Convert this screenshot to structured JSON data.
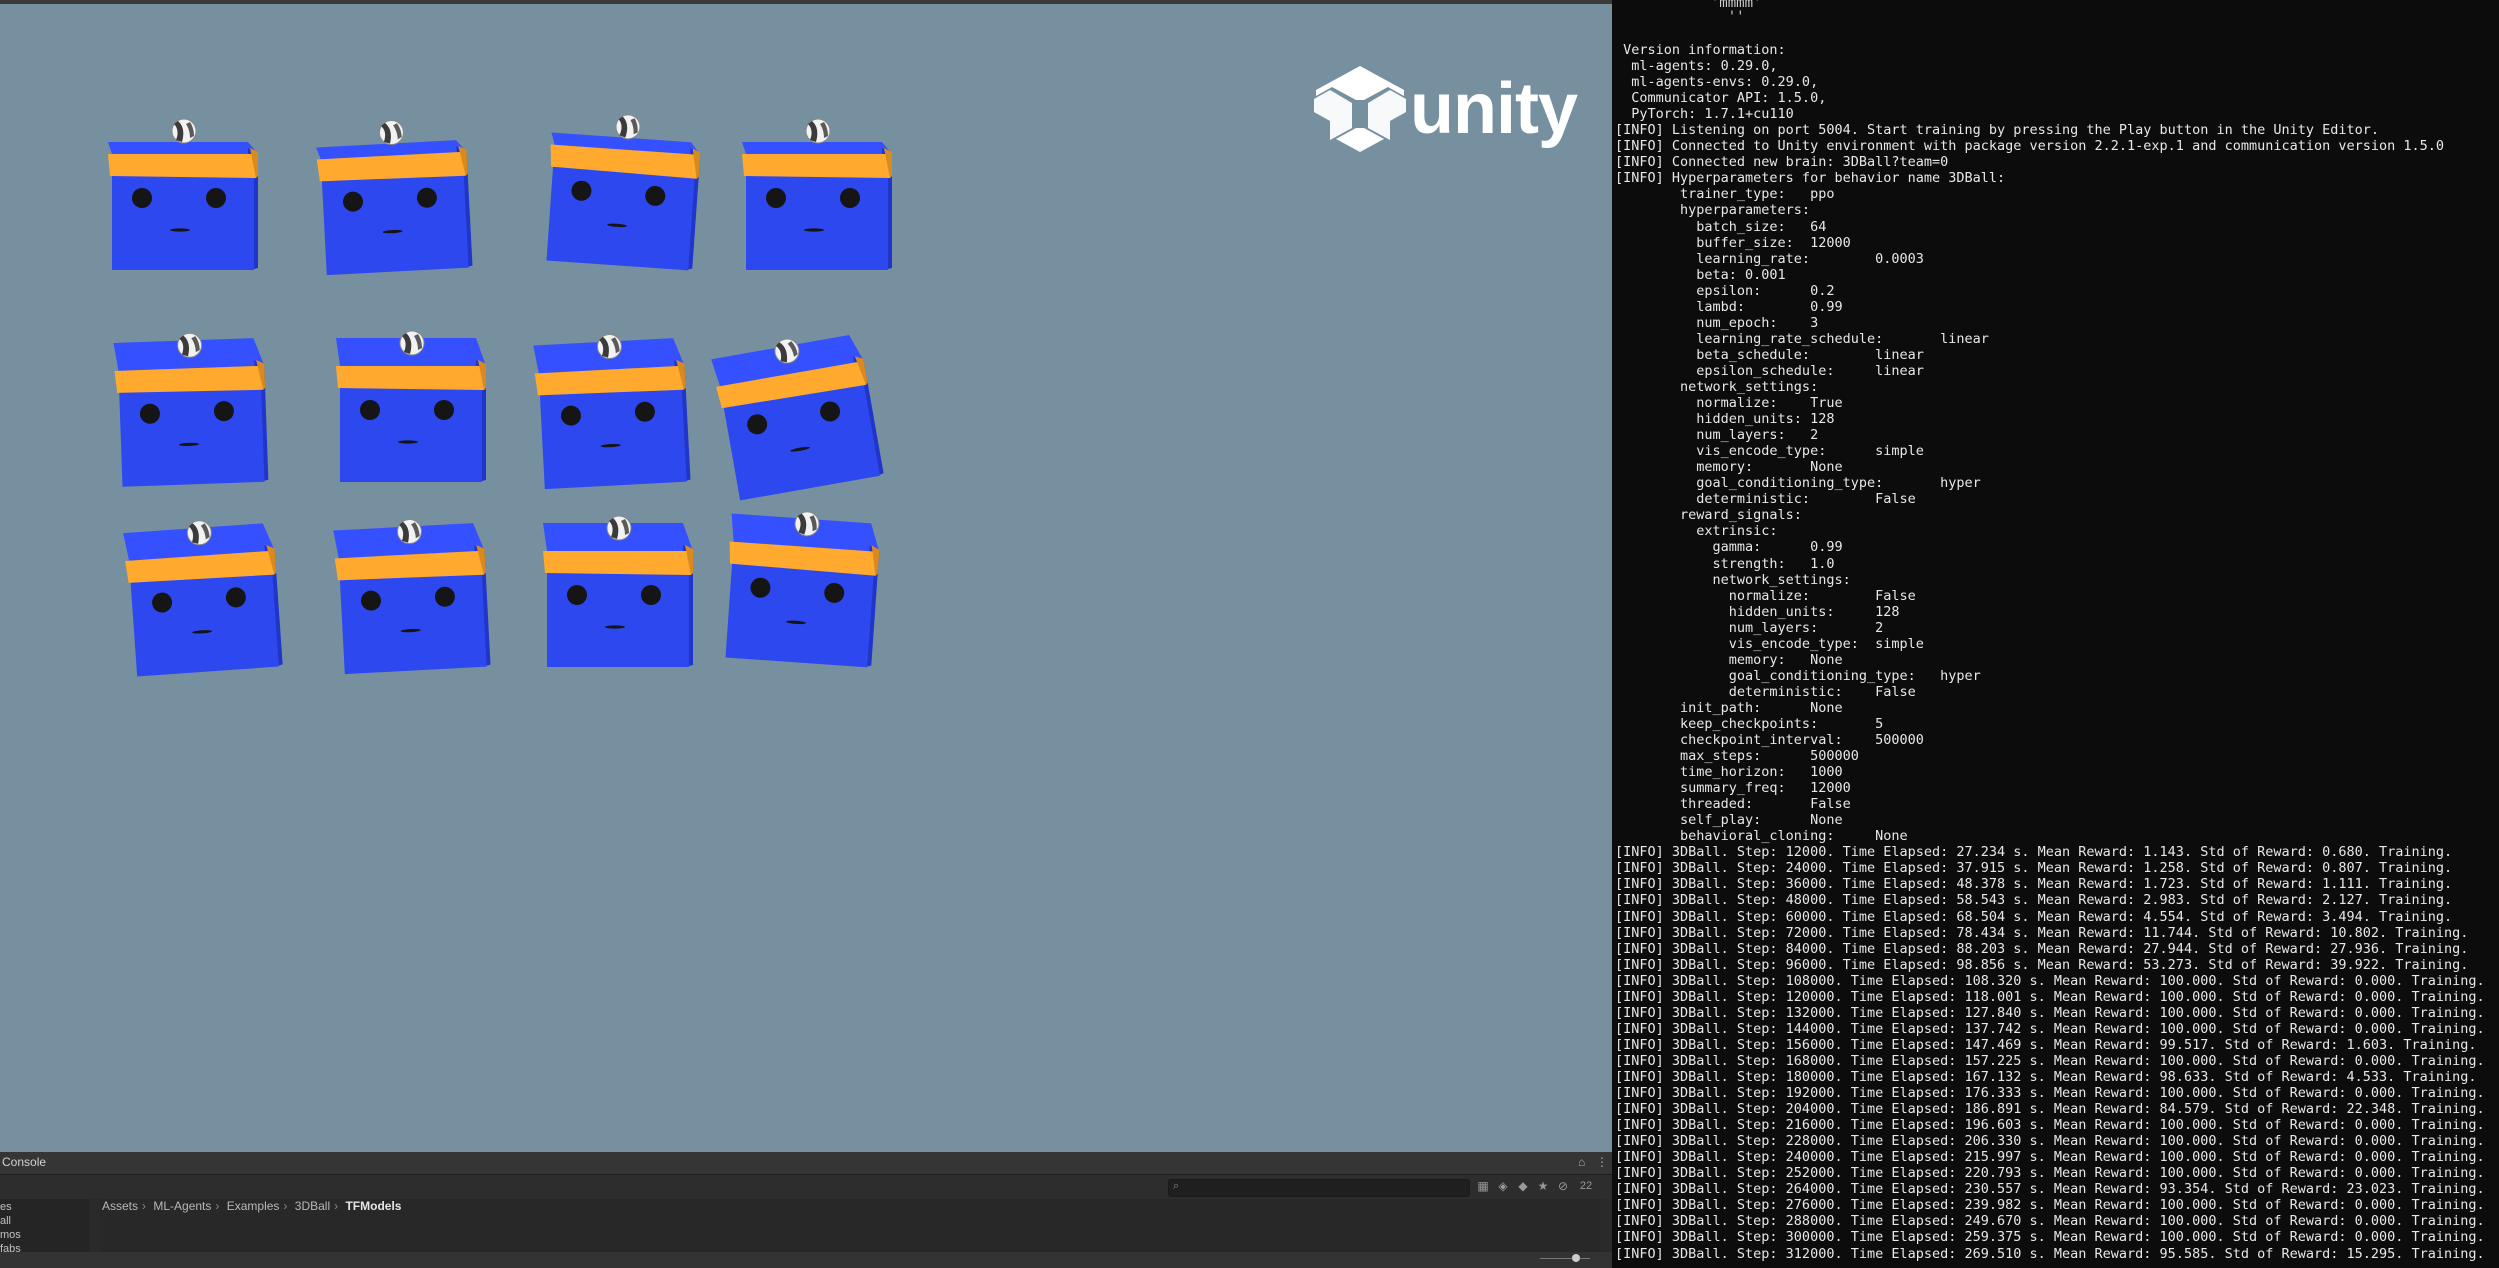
{
  "game_view": {
    "logo_text": "unity",
    "logo_icon": "unity-cube-icon",
    "background_color": "#7790a0",
    "agent_colors": {
      "body": "#2e48f0",
      "band": "#ffa92e",
      "eyes": "#151515"
    },
    "agent_count": 12,
    "ball_icon": "beach-ball-icon"
  },
  "console": {
    "tab_title": "Console",
    "left_items": [
      "es",
      "all",
      "mos",
      "fabs"
    ],
    "breadcrumb": [
      "Assets",
      "ML-Agents",
      "Examples",
      "3DBall",
      "TFModels"
    ],
    "badge_count": "22"
  },
  "terminal": {
    "ascii_fragment": "  'mmmm'\n    ''",
    "lines": [
      " Version information:",
      "  ml-agents: 0.29.0,",
      "  ml-agents-envs: 0.29.0,",
      "  Communicator API: 1.5.0,",
      "  PyTorch: 1.7.1+cu110",
      "[INFO] Listening on port 5004. Start training by pressing the Play button in the Unity Editor.",
      "[INFO] Connected to Unity environment with package version 2.2.1-exp.1 and communication version 1.5.0",
      "[INFO] Connected new brain: 3DBall?team=0",
      "[INFO] Hyperparameters for behavior name 3DBall:",
      "        trainer_type:   ppo",
      "        hyperparameters:",
      "          batch_size:   64",
      "          buffer_size:  12000",
      "          learning_rate:        0.0003",
      "          beta: 0.001",
      "          epsilon:      0.2",
      "          lambd:        0.99",
      "          num_epoch:    3",
      "          learning_rate_schedule:       linear",
      "          beta_schedule:        linear",
      "          epsilon_schedule:     linear",
      "        network_settings:",
      "          normalize:    True",
      "          hidden_units: 128",
      "          num_layers:   2",
      "          vis_encode_type:      simple",
      "          memory:       None",
      "          goal_conditioning_type:       hyper",
      "          deterministic:        False",
      "        reward_signals:",
      "          extrinsic:",
      "            gamma:      0.99",
      "            strength:   1.0",
      "            network_settings:",
      "              normalize:        False",
      "              hidden_units:     128",
      "              num_layers:       2",
      "              vis_encode_type:  simple",
      "              memory:   None",
      "              goal_conditioning_type:   hyper",
      "              deterministic:    False",
      "        init_path:      None",
      "        keep_checkpoints:       5",
      "        checkpoint_interval:    500000",
      "        max_steps:      500000",
      "        time_horizon:   1000",
      "        summary_freq:   12000",
      "        threaded:       False",
      "        self_play:      None",
      "        behavioral_cloning:     None",
      "[INFO] 3DBall. Step: 12000. Time Elapsed: 27.234 s. Mean Reward: 1.143. Std of Reward: 0.680. Training.",
      "[INFO] 3DBall. Step: 24000. Time Elapsed: 37.915 s. Mean Reward: 1.258. Std of Reward: 0.807. Training.",
      "[INFO] 3DBall. Step: 36000. Time Elapsed: 48.378 s. Mean Reward: 1.723. Std of Reward: 1.111. Training.",
      "[INFO] 3DBall. Step: 48000. Time Elapsed: 58.543 s. Mean Reward: 2.983. Std of Reward: 2.127. Training.",
      "[INFO] 3DBall. Step: 60000. Time Elapsed: 68.504 s. Mean Reward: 4.554. Std of Reward: 3.494. Training.",
      "[INFO] 3DBall. Step: 72000. Time Elapsed: 78.434 s. Mean Reward: 11.744. Std of Reward: 10.802. Training.",
      "[INFO] 3DBall. Step: 84000. Time Elapsed: 88.203 s. Mean Reward: 27.944. Std of Reward: 27.936. Training.",
      "[INFO] 3DBall. Step: 96000. Time Elapsed: 98.856 s. Mean Reward: 53.273. Std of Reward: 39.922. Training.",
      "[INFO] 3DBall. Step: 108000. Time Elapsed: 108.320 s. Mean Reward: 100.000. Std of Reward: 0.000. Training.",
      "[INFO] 3DBall. Step: 120000. Time Elapsed: 118.001 s. Mean Reward: 100.000. Std of Reward: 0.000. Training.",
      "[INFO] 3DBall. Step: 132000. Time Elapsed: 127.840 s. Mean Reward: 100.000. Std of Reward: 0.000. Training.",
      "[INFO] 3DBall. Step: 144000. Time Elapsed: 137.742 s. Mean Reward: 100.000. Std of Reward: 0.000. Training.",
      "[INFO] 3DBall. Step: 156000. Time Elapsed: 147.469 s. Mean Reward: 99.517. Std of Reward: 1.603. Training.",
      "[INFO] 3DBall. Step: 168000. Time Elapsed: 157.225 s. Mean Reward: 100.000. Std of Reward: 0.000. Training.",
      "[INFO] 3DBall. Step: 180000. Time Elapsed: 167.132 s. Mean Reward: 98.633. Std of Reward: 4.533. Training.",
      "[INFO] 3DBall. Step: 192000. Time Elapsed: 176.333 s. Mean Reward: 100.000. Std of Reward: 0.000. Training.",
      "[INFO] 3DBall. Step: 204000. Time Elapsed: 186.891 s. Mean Reward: 84.579. Std of Reward: 22.348. Training.",
      "[INFO] 3DBall. Step: 216000. Time Elapsed: 196.603 s. Mean Reward: 100.000. Std of Reward: 0.000. Training.",
      "[INFO] 3DBall. Step: 228000. Time Elapsed: 206.330 s. Mean Reward: 100.000. Std of Reward: 0.000. Training.",
      "[INFO] 3DBall. Step: 240000. Time Elapsed: 215.997 s. Mean Reward: 100.000. Std of Reward: 0.000. Training.",
      "[INFO] 3DBall. Step: 252000. Time Elapsed: 220.793 s. Mean Reward: 100.000. Std of Reward: 0.000. Training.",
      "[INFO] 3DBall. Step: 264000. Time Elapsed: 230.557 s. Mean Reward: 93.354. Std of Reward: 23.023. Training.",
      "[INFO] 3DBall. Step: 276000. Time Elapsed: 239.982 s. Mean Reward: 100.000. Std of Reward: 0.000. Training.",
      "[INFO] 3DBall. Step: 288000. Time Elapsed: 249.670 s. Mean Reward: 100.000. Std of Reward: 0.000. Training.",
      "[INFO] 3DBall. Step: 300000. Time Elapsed: 259.375 s. Mean Reward: 100.000. Std of Reward: 0.000. Training.",
      "[INFO] 3DBall. Step: 312000. Time Elapsed: 269.510 s. Mean Reward: 95.585. Std of Reward: 15.295. Training."
    ]
  }
}
